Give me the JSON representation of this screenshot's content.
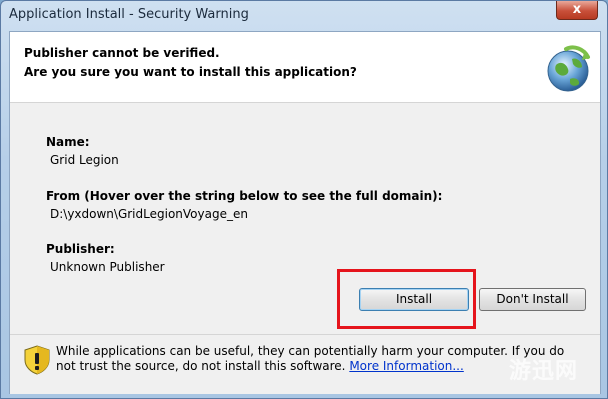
{
  "window": {
    "title": "Application Install - Security Warning",
    "close_glyph": "x"
  },
  "header": {
    "line1": "Publisher cannot be verified.",
    "line2": "Are you sure you want to install this application?",
    "icon": "globe-install-icon"
  },
  "details": {
    "name_label": "Name:",
    "name_value": "Grid Legion",
    "from_label": "From (Hover over the string below to see the full domain):",
    "from_value": "D:\\yxdown\\GridLegionVoyage_en",
    "publisher_label": "Publisher:",
    "publisher_value": "Unknown Publisher"
  },
  "buttons": {
    "install_label": "Install",
    "dont_install_label": "Don't Install"
  },
  "footer": {
    "warning_text": "While applications can be useful, they can potentially harm your computer. If you do not trust the source, do not install this software.",
    "link_text": "More Information...",
    "icon": "shield-warning-icon"
  },
  "watermark": {
    "text": "游迅网"
  },
  "colors": {
    "highlight": "#e5141c",
    "link": "#0033cc",
    "close_button": "#c8503a"
  }
}
